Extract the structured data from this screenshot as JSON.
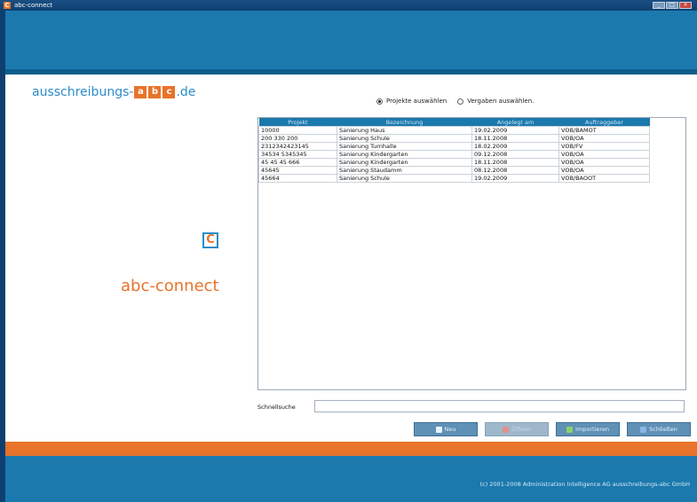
{
  "window": {
    "title": "abc-connect",
    "app_icon": "C"
  },
  "brand": {
    "prefix": "ausschreibungs-",
    "boxes": [
      "a",
      "b",
      "c"
    ],
    "suffix": ".de",
    "logo_letter": "C",
    "name": "abc-connect"
  },
  "radios": [
    {
      "label": "Projekte auswählen",
      "checked": true
    },
    {
      "label": "Vergaben auswählen.",
      "checked": false
    }
  ],
  "table": {
    "headers": [
      "Projekt",
      "Bezeichnung",
      "Angelegt am",
      "Auftraggeber"
    ],
    "rows": [
      [
        "10000",
        "Sanierung Haus",
        "19.02.2009",
        "VOB/BAMOT"
      ],
      [
        "200 330 200",
        "Sanierung Schule",
        "18.11.2008",
        "VOB/OA"
      ],
      [
        "2312342423145",
        "Sanierung Turnhalle",
        "18.02.2009",
        "VOB/FV"
      ],
      [
        "34534 5345345",
        "Sanierung Kindergarten",
        "09.12.2008",
        "VOB/OA"
      ],
      [
        "45 45 45 666",
        "Sanierung Kindergarten",
        "18.11.2008",
        "VOB/OA"
      ],
      [
        "45645",
        "Sanierung Staudamm",
        "08.12.2008",
        "VOB/OA"
      ],
      [
        "45664",
        "Sanierung Schule",
        "19.02.2009",
        "VOB/BAOOT"
      ]
    ]
  },
  "search": {
    "label": "Schnellsuche",
    "value": ""
  },
  "buttons": [
    {
      "label": "Neu",
      "icon": "new-icon",
      "enabled": true
    },
    {
      "label": "Öffnen",
      "icon": "delete-icon",
      "enabled": false
    },
    {
      "label": "Importieren",
      "icon": "import-icon",
      "enabled": true
    },
    {
      "label": "Schließen",
      "icon": "close-icon",
      "enabled": true
    }
  ],
  "footer": {
    "copyright": "(c) 2001-2008 Administration Intelligence AG ausschreibungs-abc GmbH"
  },
  "colors": {
    "header": "#1b79ae",
    "accent": "#e8732a",
    "brand_blue": "#2d8cc8"
  }
}
